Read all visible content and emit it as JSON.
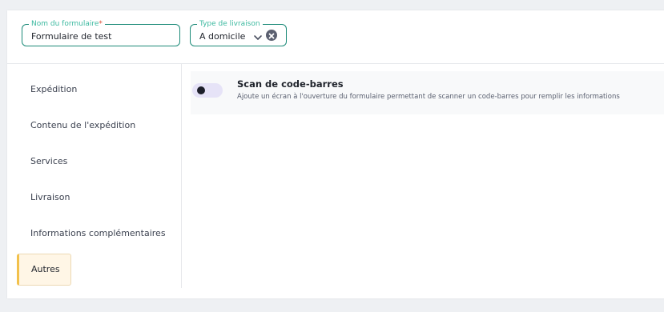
{
  "header": {
    "form_name": {
      "label": "Nom du formulaire",
      "required_marker": "*",
      "value": "Formulaire de test"
    },
    "delivery_type": {
      "label": "Type de livraison",
      "value": "A domicile",
      "icons": [
        "chevron-down-icon",
        "clear-icon"
      ]
    }
  },
  "sidebar": {
    "items": [
      {
        "label": "Expédition",
        "active": false
      },
      {
        "label": "Contenu de l'expédition",
        "active": false
      },
      {
        "label": "Services",
        "active": false
      },
      {
        "label": "Livraison",
        "active": false
      },
      {
        "label": "Informations complémentaires",
        "active": false
      },
      {
        "label": "Autres",
        "active": true
      }
    ]
  },
  "main": {
    "options": [
      {
        "title": "Scan de code-barres",
        "description": "Ajoute un écran à l'ouverture du formulaire permettant de scanner un code-barres pour remplir les informations",
        "enabled": false
      }
    ]
  },
  "colors": {
    "accent": "#1b8a78",
    "legend": "#3db9a0",
    "active_bar": "#f2c14c",
    "active_bg": "#fff6e6",
    "toggle_track": "#e6e3f7"
  }
}
